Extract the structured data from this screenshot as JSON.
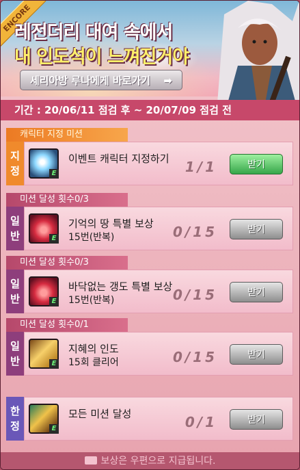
{
  "banner": {
    "ribbon": "ENCORE",
    "title_line1": "레전더리 대여 속에서",
    "title_line2": "내 인도석이 느껴진거야",
    "goto_button": "세리아방 루나에게 바로가기",
    "arrow": "➡"
  },
  "period": "기간 : 20/06/11 점검 후 ~ 20/07/09 점검 전",
  "missions": [
    {
      "header": "캐릭터 지정 미션",
      "side": "지정",
      "icon": "lightning-icon",
      "title": "이벤트 캐릭터 지정하기",
      "subtitle": "",
      "progress": "1/1",
      "claim": "받기",
      "claim_state": "active"
    },
    {
      "header": "미션 달성 횟수0/3",
      "side": "일반",
      "icon": "rose-icon",
      "title": "기억의 땅 특별 보상",
      "subtitle": "15번(반복)",
      "progress": "0/15",
      "claim": "받기",
      "claim_state": "inactive"
    },
    {
      "header": "미션 달성 횟수0/3",
      "side": "일반",
      "icon": "rose-icon",
      "title": "바닥없는 갱도 특별 보상",
      "subtitle": "15번(반복)",
      "progress": "0/15",
      "claim": "받기",
      "claim_state": "inactive"
    },
    {
      "header": "미션 달성 횟수0/1",
      "side": "일반",
      "icon": "scroll-icon",
      "title": "지혜의 인도",
      "subtitle": "15회 클리어",
      "progress": "0/15",
      "claim": "받기",
      "claim_state": "inactive"
    },
    {
      "header": "",
      "side": "한정",
      "icon": "treasure-chest-icon",
      "title": "모든 미션 달성",
      "subtitle": "",
      "progress": "0/1",
      "claim": "받기",
      "claim_state": "inactive"
    }
  ],
  "footer": "보상은 우편으로 지급됩니다.",
  "icon_e": "E",
  "colors": {
    "accent": "#c7486a",
    "claim_active": "#36a64a",
    "claim_inactive": "#8e8e8e"
  }
}
